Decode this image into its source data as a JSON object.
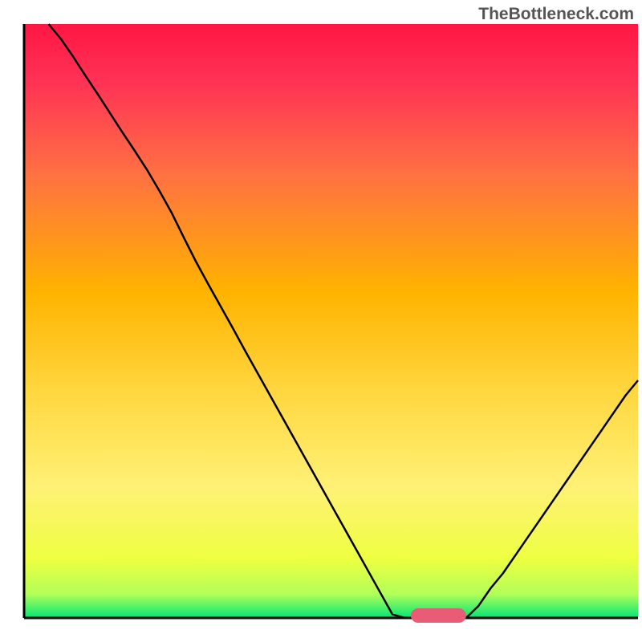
{
  "watermark": "TheBottleneck.com",
  "chart_data": {
    "type": "line",
    "title": "",
    "xlabel": "",
    "ylabel": "",
    "xlim": [
      0,
      100
    ],
    "ylim": [
      0,
      100
    ],
    "x": [
      4,
      6,
      8,
      10,
      12,
      14,
      16,
      18,
      20,
      22,
      24,
      26,
      28,
      30,
      32,
      34,
      36,
      38,
      40,
      42,
      44,
      46,
      48,
      50,
      52,
      54,
      56,
      58,
      60,
      62,
      64,
      66,
      68,
      70,
      72,
      74,
      76,
      78,
      80,
      82,
      84,
      86,
      88,
      90,
      92,
      94,
      96,
      98,
      100
    ],
    "values": [
      100,
      97.5,
      94.5,
      91.3,
      88.2,
      85.0,
      81.8,
      78.7,
      75.5,
      72.0,
      68.3,
      64.1,
      60.0,
      56.2,
      52.5,
      48.8,
      45.0,
      41.3,
      37.6,
      33.9,
      30.2,
      26.5,
      22.8,
      19.1,
      15.4,
      11.7,
      8.0,
      4.3,
      0.6,
      0.0,
      0.0,
      0.0,
      0.0,
      0.0,
      0.0,
      2.0,
      5.0,
      7.5,
      10.5,
      13.5,
      16.5,
      19.5,
      22.5,
      25.5,
      28.5,
      31.5,
      34.5,
      37.5,
      40.0
    ],
    "marker": {
      "x_start": 63,
      "x_end": 72,
      "y": 0,
      "color": "#e85d75"
    },
    "background_gradient": {
      "type": "vertical",
      "stops": [
        {
          "offset": 0.0,
          "color": "#ff1744"
        },
        {
          "offset": 0.1,
          "color": "#ff3355"
        },
        {
          "offset": 0.25,
          "color": "#ff7043"
        },
        {
          "offset": 0.45,
          "color": "#ffb300"
        },
        {
          "offset": 0.62,
          "color": "#ffd740"
        },
        {
          "offset": 0.78,
          "color": "#fff176"
        },
        {
          "offset": 0.9,
          "color": "#eeff41"
        },
        {
          "offset": 0.96,
          "color": "#b2ff59"
        },
        {
          "offset": 1.0,
          "color": "#00e676"
        }
      ]
    }
  }
}
